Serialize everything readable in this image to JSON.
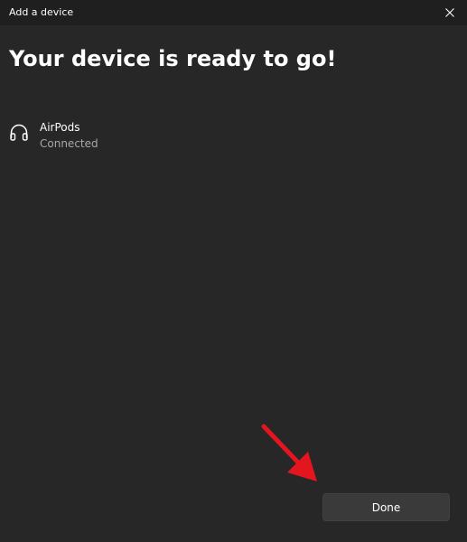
{
  "window": {
    "title": "Add a device",
    "close_icon": "close-icon"
  },
  "main": {
    "heading": "Your device is ready to go!",
    "device": {
      "icon": "headphones-icon",
      "name": "AirPods",
      "status": "Connected"
    },
    "done_label": "Done"
  },
  "colors": {
    "background": "#272727",
    "titlebar": "#1f1f1f",
    "button": "#3a3a3a",
    "annotation_arrow": "#e3161f"
  }
}
